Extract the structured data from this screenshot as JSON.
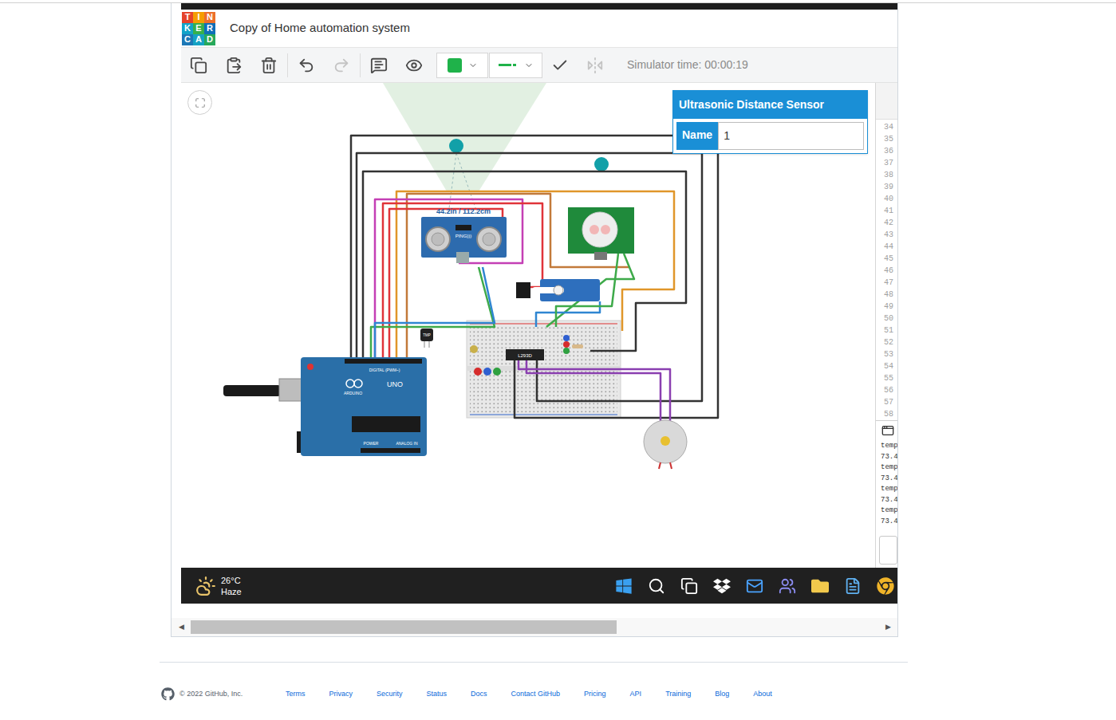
{
  "window": {
    "title": "Copy of Home automation system"
  },
  "logo": [
    {
      "letter": "T",
      "color": "#e5432b"
    },
    {
      "letter": "I",
      "color": "#f59d00"
    },
    {
      "letter": "N",
      "color": "#ec6f2a"
    },
    {
      "letter": "K",
      "color": "#12a3c8"
    },
    {
      "letter": "E",
      "color": "#36b04b"
    },
    {
      "letter": "R",
      "color": "#0f6fb7"
    },
    {
      "letter": "C",
      "color": "#1d78b6"
    },
    {
      "letter": "A",
      "color": "#15a2c4"
    },
    {
      "letter": "D",
      "color": "#27a95c"
    }
  ],
  "toolbar": {
    "buttons": [
      {
        "disabled": false
      },
      {
        "disabled": false
      },
      {
        "disabled": false
      },
      {
        "disabled": false
      },
      {
        "disabled": true
      },
      {
        "disabled": false
      },
      {
        "disabled": false
      },
      {
        "disabled": false
      },
      {
        "disabled": true
      }
    ],
    "wire_color": "#1fb24a",
    "simulator_time": "Simulator time: 00:00:19"
  },
  "inspector": {
    "title": "Ultrasonic Distance Sensor",
    "field_label": "Name",
    "field_value": "1"
  },
  "circuit": {
    "distance_reading": "44.2in / 112.2cm",
    "sensor_label": "PING)))",
    "arduino_model": "UNO",
    "arduino_brand": "ARDUINO",
    "digital_label": "DIGITAL (PWM~)",
    "power_label": "POWER",
    "analog_label": "ANALOG IN",
    "driver_chip": "L293D",
    "temp_sensor": "TMP"
  },
  "code_panel": {
    "line_numbers": [
      "34",
      "35",
      "36",
      "37",
      "38",
      "39",
      "40",
      "41",
      "42",
      "43",
      "44",
      "45",
      "46",
      "47",
      "48",
      "49",
      "50",
      "51",
      "52",
      "53",
      "54",
      "55",
      "56",
      "57",
      "58"
    ]
  },
  "serial_monitor": {
    "lines": [
      "temp",
      "73.4",
      "temp",
      "73.4",
      "temp",
      "73.4",
      "temp",
      "73.4"
    ]
  },
  "taskbar": {
    "temperature": "26°C",
    "condition": "Haze"
  },
  "scrollbar": {
    "left_arrow": "◀",
    "right_arrow": "▶",
    "level": 0.62
  },
  "footer": {
    "copyright": "© 2022 GitHub, Inc.",
    "links": [
      "Terms",
      "Privacy",
      "Security",
      "Status",
      "Docs",
      "Contact GitHub",
      "Pricing",
      "API",
      "Training",
      "Blog",
      "About"
    ]
  }
}
